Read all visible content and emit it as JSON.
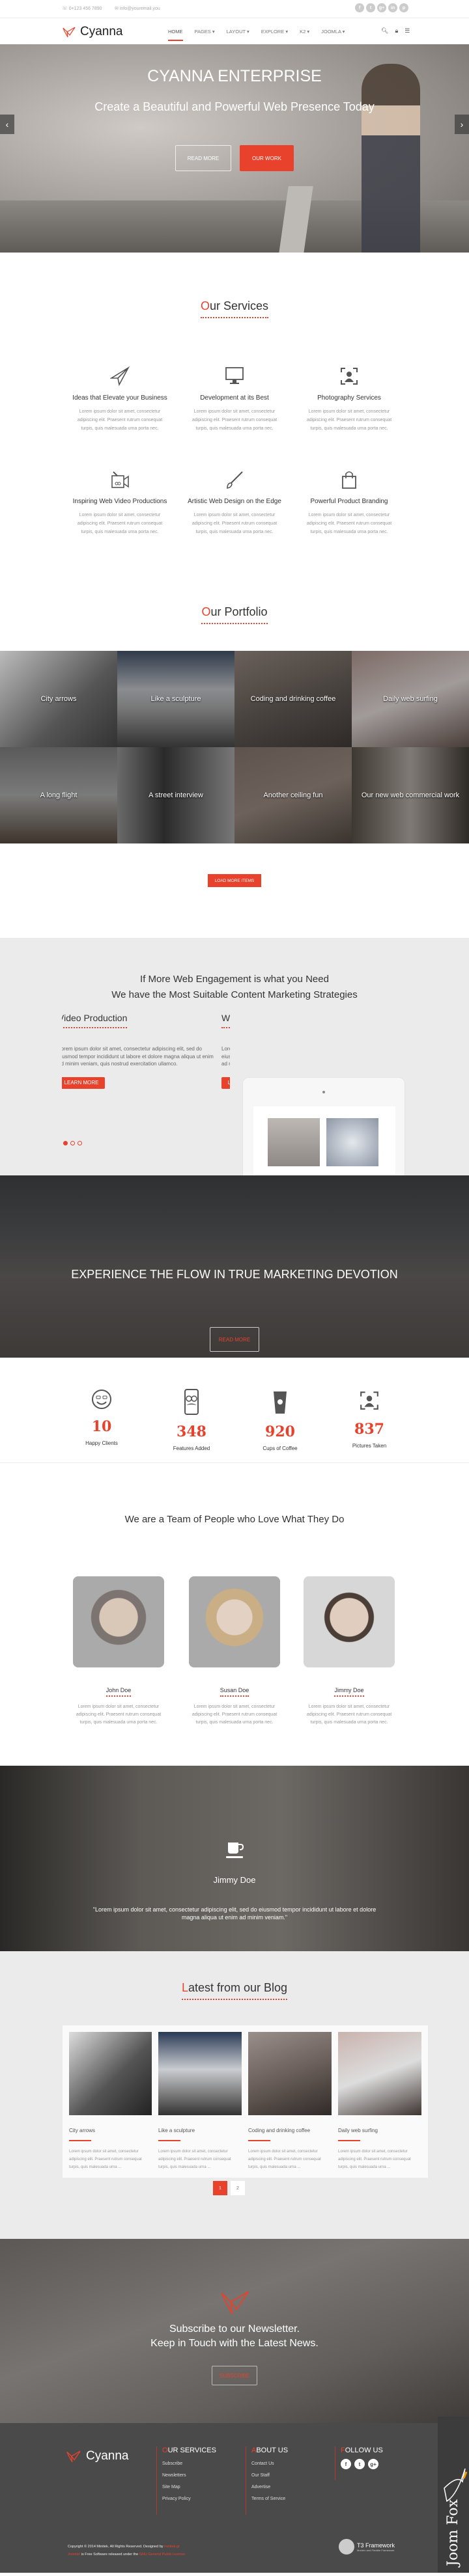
{
  "colors": {
    "accent": "#e8412c",
    "dark_footer": "#4a4a4a",
    "light_bg": "#ebebeb"
  },
  "topbar": {
    "phone": "0+123 456 7890",
    "email": "info@youremail.you",
    "phone_icon": "phone-icon",
    "email_icon": "envelope-icon",
    "social": [
      "f",
      "t",
      "g+",
      "in",
      "p"
    ]
  },
  "nav": {
    "brand": "Cyanna",
    "items": [
      {
        "label": "HOME",
        "active": true
      },
      {
        "label": "PAGES ▾"
      },
      {
        "label": "LAYOUT ▾"
      },
      {
        "label": "EXPLORE ▾"
      },
      {
        "label": "K2 ▾"
      },
      {
        "label": "JOOMLA ▾"
      }
    ],
    "icons": [
      "search-icon",
      "lock-icon",
      "menu-icon"
    ]
  },
  "hero": {
    "title": "CYANNA ENTERPRISE",
    "subtitle": "Create a Beautiful and Powerful Web Presence Today",
    "read_more": "READ MORE",
    "our_work": "OUR WORK",
    "prev": "‹",
    "next": "›"
  },
  "services": {
    "title_first": "O",
    "title_rest": "ur Services",
    "items": [
      {
        "icon": "paper-plane-icon",
        "title": "Ideas that Elevate your Business",
        "text": "Lorem ipsum dolor sit amet, consectetur adipiscing elit. Praesent rutrum consequat turpis, quis malesuada urna porta nec."
      },
      {
        "icon": "monitor-icon",
        "title": "Development at its Best",
        "text": "Lorem ipsum dolor sit amet, consectetur adipiscing elit. Praesent rutrum consequat turpis, quis malesuada urna porta nec."
      },
      {
        "icon": "portrait-focus-icon",
        "title": "Photography Services",
        "text": "Lorem ipsum dolor sit amet, consectetur adipiscing elit. Praesent rutrum consequat turpis, quis malesuada urna porta nec."
      },
      {
        "icon": "video-camera-icon",
        "title": "Inspiring Web Video Productions",
        "text": "Lorem ipsum dolor sit amet, consectetur adipiscing elit. Praesent rutrum consequat turpis, quis malesuada urna porta nec."
      },
      {
        "icon": "paintbrush-icon",
        "title": "Artistic Web Design on the Edge",
        "text": "Lorem ipsum dolor sit amet, consectetur adipiscing elit. Praesent rutrum consequat turpis, quis malesuada urna porta nec."
      },
      {
        "icon": "shopping-bag-icon",
        "title": "Powerful Product Branding",
        "text": "Lorem ipsum dolor sit amet, consectetur adipiscing elit. Praesent rutrum consequat turpis, quis malesuada urna porta nec."
      }
    ]
  },
  "portfolio": {
    "title_first": "O",
    "title_rest": "ur Portfolio",
    "items": [
      "City arrows",
      "Like a sculpture",
      "Coding and drinking coffee",
      "Daily web surfing",
      "A long flight",
      "A street interview",
      "Another ceiling fun",
      "Our new web commercial work"
    ],
    "load_more": "LOAD MORE ITEMS"
  },
  "engagement": {
    "line1": "If More Web Engagement is what you Need",
    "line2": "We have the Most Suitable Content Marketing Strategies",
    "slides": [
      {
        "title": "Video Production",
        "text": "Lorem ipsum dolor sit amet, consectetur adipiscing elit, sed do eiusmod tempor incididunt ut labore et dolore magna aliqua ut enim ad minim veniam, quis nostrud exercitation ullamco.",
        "button": "LEARN MORE"
      },
      {
        "title": "W",
        "text": "Lorem ipsum dolor sit amet, consectetur adipiscing elit, sed do eiusmod tempor incididunt ut labore et dolore magna aliqua ut enim ad minim veniam, quis nostrud exercitation ullamco.",
        "button": "LEARN MORE"
      }
    ],
    "active_slide": 1,
    "slide_count": 3
  },
  "flow": {
    "title": "EXPERIENCE THE FLOW IN TRUE MARKETING DEVOTION",
    "button": "READ MORE"
  },
  "stats": [
    {
      "icon": "smiley-glasses-icon",
      "value": "10",
      "label": "Happy Clients"
    },
    {
      "icon": "phone-mustache-icon",
      "value": "348",
      "label": "Features Added"
    },
    {
      "icon": "coffee-cup-icon",
      "value": "920",
      "label": "Cups of Coffee"
    },
    {
      "icon": "portrait-focus-icon",
      "value": "837",
      "label": "Pictures Taken"
    }
  ],
  "team": {
    "title": "We are a Team of People who Love What They Do",
    "members": [
      {
        "name": "John Doe",
        "text": "Lorem ipsum dolor sit amet, consectetur adipiscing elit. Praesent rutrum consequat turpis, quis malesuada urna porta nec."
      },
      {
        "name": "Susan Doe",
        "text": "Lorem ipsum dolor sit amet, consectetur adipiscing elit. Praesent rutrum consequat turpis, quis malesuada urna porta nec."
      },
      {
        "name": "Jimmy Doe",
        "text": "Lorem ipsum dolor sit amet, consectetur adipiscing elit. Praesent rutrum consequat turpis, quis malesuada urna porta nec."
      }
    ]
  },
  "testimonial": {
    "icon": "coffee-cup-icon",
    "name": "Jimmy Doe",
    "quote": "\"Lorem ipsum dolor sit amet, consectetur adipiscing elit, sed do eiusmod tempor incididunt ut labore et dolore magna aliqua ut enim ad minim veniam.\"",
    "active_dot": 3,
    "dot_count": 3
  },
  "blog": {
    "title_first": "L",
    "title_rest": "atest from our Blog",
    "posts": [
      {
        "title": "City arrows",
        "text": "Lorem ipsum dolor sit amet, consectetur adipiscing elit. Praesent rutrum consequat turpis, quis malesuada urna ..."
      },
      {
        "title": "Like a sculpture",
        "text": "Lorem ipsum dolor sit amet, consectetur adipiscing elit. Praesent rutrum consequat turpis, quis malesuada urna ..."
      },
      {
        "title": "Coding and drinking coffee",
        "text": "Lorem ipsum dolor sit amet, consectetur adipiscing elit. Praesent rutrum consequat turpis, quis malesuada urna ..."
      },
      {
        "title": "Daily web surfing",
        "text": "Lorem ipsum dolor sit amet, consectetur adipiscing elit. Praesent rutrum consequat turpis, quis malesuada urna ..."
      }
    ],
    "pages": [
      "1",
      "2"
    ],
    "current_page": "1"
  },
  "newsletter": {
    "line1": "Subscribe to our Newsletter.",
    "line2": "Keep in Touch with the Latest News.",
    "button": "SUBSCRIBE"
  },
  "footer": {
    "brand": "Cyanna",
    "services": {
      "title_first": "O",
      "title_rest": "UR SERVICES",
      "links": [
        "Subscribe",
        "Newsletters",
        "Site Map",
        "Privacy Policy"
      ]
    },
    "about": {
      "title_first": "A",
      "title_rest": "BOUT US",
      "links": [
        "Contact Us",
        "Our Staff",
        "Advertise",
        "Terms of Service"
      ]
    },
    "follow": {
      "title_first": "F",
      "title_rest": "OLLOW US",
      "social": [
        "f",
        "t",
        "g+"
      ]
    },
    "copyright": "Copyright © 2014 Minitek. All Rights Reserved. Designed by ",
    "designer": "minitek.gr",
    "license_pre": "Joomla!",
    "license_mid": " is Free Software released under the ",
    "license_link": "GNU General Public License",
    "t3_title": "T3 Framework",
    "t3_sub": "Modern and Flexible Framework",
    "watermark": "JoomFox CREATIVE WEB STUDIO"
  }
}
